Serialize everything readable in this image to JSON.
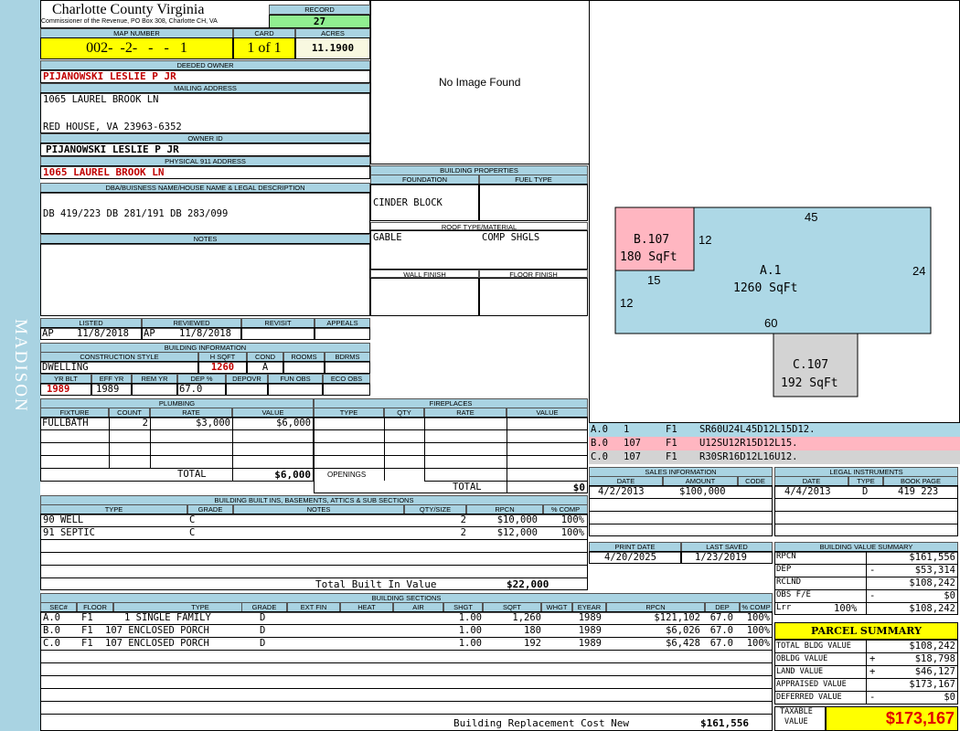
{
  "sidebar": {
    "label": "MADISON"
  },
  "header": {
    "county": "Charlotte County Virginia",
    "subtitle": "Commissioner of the Revenue, PO Box 308, Charlotte CH, VA",
    "record_label": "RECORD",
    "record": "27",
    "map_label": "MAP NUMBER",
    "map_number": "002-  -2-   -   -   1",
    "card_label": "CARD",
    "card": "1 of 1",
    "acres_label": "ACRES",
    "acres": "11.1900"
  },
  "owner": {
    "deeded_label": "DEEDED OWNER",
    "deeded": "PIJANOWSKI LESLIE P JR",
    "mailing_label": "MAILING ADDRESS",
    "mail1": "1065 LAUREL BROOK LN",
    "mail2": "RED HOUSE, VA 23963-6352",
    "id_label": "OWNER ID",
    "owner_id": "PIJANOWSKI LESLIE P JR",
    "phys_label": "PHYSICAL 911 ADDRESS",
    "physical": "1065 LAUREL BROOK LN",
    "dba_label": "DBA/BUISNESS NAME/HOUSE NAME & LEGAL DESCRIPTION",
    "legal": "DB 419/223 DB 281/191 DB 283/099",
    "notes_label": "NOTES"
  },
  "image": {
    "no_image": "No Image Found"
  },
  "building_props": {
    "title": "BUILDING PROPERTIES",
    "foundation_label": "FOUNDATION",
    "fuel_label": "FUEL TYPE",
    "foundation": "CINDER BLOCK",
    "roof_label": "ROOF TYPE/MATERIAL",
    "roof_type": "GABLE",
    "roof_material": "COMP SHGLS",
    "wall_label": "WALL FINISH",
    "floor_label": "FLOOR FINISH"
  },
  "listed": {
    "listed_label": "LISTED",
    "reviewed_label": "REVIEWED",
    "revisit_label": "REVISIT",
    "appeals_label": "APPEALS",
    "listed_by": "AP",
    "listed_date": "11/8/2018",
    "reviewed_by": "AP",
    "reviewed_date": "11/8/2018"
  },
  "building_info": {
    "title": "BUILDING INFORMATION",
    "h_style": "CONSTRUCTION STYLE",
    "h_sqft": "H SQFT",
    "h_cond": "COND",
    "h_rooms": "ROOMS",
    "h_bdrms": "BDRMS",
    "style": "DWELLING",
    "sqft": "1260",
    "cond": "A",
    "h_yrblt": "YR BLT",
    "h_effyr": "EFF YR",
    "h_remyr": "REM YR",
    "h_dep": "DEP %",
    "h_depovr": "DEPOVR",
    "h_funobs": "FUN OBS",
    "h_ecoobs": "ECO OBS",
    "yrblt": "1989",
    "effyr": "1989",
    "dep": "67.0"
  },
  "plumbing": {
    "title": "PLUMBING",
    "h_fixture": "FIXTURE",
    "h_count": "COUNT",
    "h_rate": "RATE",
    "h_value": "VALUE",
    "rows": [
      {
        "fixture": "FULLBATH",
        "count": "2",
        "rate": "$3,000",
        "value": "$6,000"
      }
    ],
    "total_label": "TOTAL",
    "total": "$6,000"
  },
  "fireplaces": {
    "title": "FIREPLACES",
    "h_type": "TYPE",
    "h_qty": "QTY",
    "h_rate": "RATE",
    "h_value": "VALUE",
    "openings_label": "OPENINGS",
    "total_label": "TOTAL",
    "total": "$0"
  },
  "builtins": {
    "title": "BUILDING BUILT INS, BASEMENTS, ATTICS & SUB SECTIONS",
    "h_type": "TYPE",
    "h_grade": "GRADE",
    "h_notes": "NOTES",
    "h_qty": "QTY/SIZE",
    "h_rpcn": "RPCN",
    "h_comp": "% COMP",
    "rows": [
      {
        "type": "90 WELL",
        "grade": "C",
        "qty": "2",
        "rpcn": "$10,000",
        "comp": "100%"
      },
      {
        "type": "91 SEPTIC",
        "grade": "C",
        "qty": "2",
        "rpcn": "$12,000",
        "comp": "100%"
      }
    ],
    "total_label": "Total Built In Value",
    "total": "$22,000"
  },
  "sketch": {
    "a_label": "A.1",
    "a_sqft": "1260 SqFt",
    "b_label": "B.107",
    "b_sqft": "180 SqFt",
    "c_label": "C.107",
    "c_sqft": "192 SqFt",
    "dim_45": "45",
    "dim_24": "24",
    "dim_60": "60",
    "dim_12a": "12",
    "dim_15": "15",
    "dim_12b": "12",
    "colors": {
      "a": "#add8e6",
      "b": "#ffb6c1",
      "c": "#d3d3d3"
    }
  },
  "sketch_codes": [
    {
      "sec": "A.0",
      "n": "1",
      "fl": "F1",
      "code": "SR60U24L45D12L15D12."
    },
    {
      "sec": "B.0",
      "n": "107",
      "fl": "F1",
      "code": "U12SU12R15D12L15."
    },
    {
      "sec": "C.0",
      "n": "107",
      "fl": "F1",
      "code": "R30SR16D12L16U12."
    }
  ],
  "sales": {
    "title": "SALES INFORMATION",
    "h_date": "DATE",
    "h_amount": "AMOUNT",
    "h_code": "CODE",
    "date": "4/2/2013",
    "amount": "$100,000"
  },
  "legal_instr": {
    "title": "LEGAL INSTRUMENTS",
    "h_date": "DATE",
    "h_type": "TYPE",
    "h_book": "BOOK PAGE",
    "date": "4/4/2013",
    "type": "D",
    "book": "419 223"
  },
  "print": {
    "print_label": "PRINT DATE",
    "saved_label": "LAST SAVED",
    "print_date": "4/20/2025",
    "last_saved": "1/23/2019"
  },
  "value_summary": {
    "title": "BUILDING VALUE SUMMARY",
    "rpcn_label": "RPCN",
    "rpcn": "$161,556",
    "dep_label": "DEP",
    "dep_sign": "-",
    "dep": "$53,314",
    "rclnd_label": "RCLND",
    "rclnd": "$108,242",
    "obs_label": "OBS F/E",
    "obs_sign": "-",
    "obs": "$0",
    "lrr_label": "Lrr",
    "lrr_pct": "100%",
    "lrr": "$108,242"
  },
  "parcel": {
    "title": "PARCEL SUMMARY",
    "tb_label": "TOTAL BLDG VALUE",
    "tb": "$108,242",
    "ob_label": "OBLDG VALUE",
    "ob_sign": "+",
    "ob": "$18,798",
    "land_label": "LAND VALUE",
    "land_sign": "+",
    "land": "$46,127",
    "appr_label": "APPRAISED VALUE",
    "appr": "$173,167",
    "def_label": "DEFERRED VALUE",
    "def_sign": "-",
    "def": "$0",
    "tax_label1": "TAXABLE",
    "tax_label2": "VALUE",
    "taxable": "$173,167"
  },
  "sections": {
    "title": "BUILDING SECTIONS",
    "h_sec": "SEC#",
    "h_floor": "FLOOR",
    "h_type": "TYPE",
    "h_grade": "GRADE",
    "h_extfin": "EXT FIN",
    "h_heat": "HEAT",
    "h_air": "AIR",
    "h_shgt": "SHGT",
    "h_sqft": "SQFT",
    "h_whgt": "WHGT",
    "h_eyear": "EYEAR",
    "h_rpcn": "RPCN",
    "h_dep": "DEP",
    "h_comp": "% COMP",
    "rows": [
      {
        "sec": "A.0",
        "floor": "F1",
        "type": "1 SINGLE FAMILY",
        "grade": "D",
        "shgt": "1.00",
        "sqft": "1,260",
        "eyear": "1989",
        "rpcn": "$121,102",
        "dep": "67.0",
        "comp": "100%"
      },
      {
        "sec": "B.0",
        "floor": "F1",
        "type": "107 ENCLOSED PORCH",
        "grade": "D",
        "shgt": "1.00",
        "sqft": "180",
        "eyear": "1989",
        "rpcn": "$6,026",
        "dep": "67.0",
        "comp": "100%"
      },
      {
        "sec": "C.0",
        "floor": "F1",
        "type": "107 ENCLOSED PORCH",
        "grade": "D",
        "shgt": "1.00",
        "sqft": "192",
        "eyear": "1989",
        "rpcn": "$6,428",
        "dep": "67.0",
        "comp": "100%"
      }
    ],
    "brcn_label": "Building Replacement Cost New",
    "brcn": "$161,556"
  }
}
